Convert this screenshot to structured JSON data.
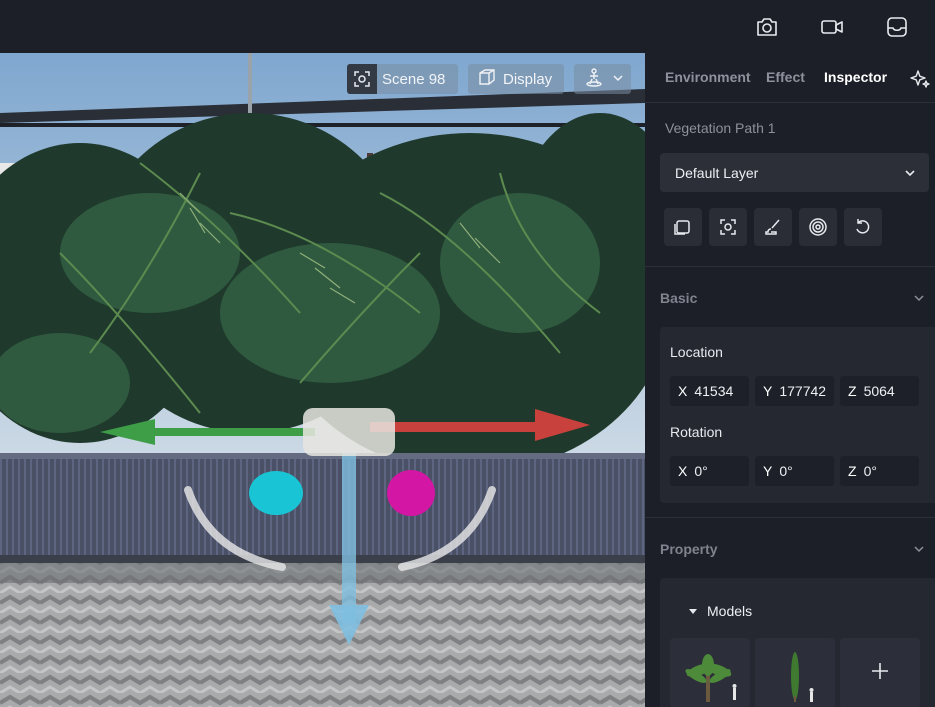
{
  "topbar": {
    "icons": [
      "camera-icon",
      "video-camera-icon",
      "inbox-tray-icon"
    ]
  },
  "viewport": {
    "scene_chip": {
      "label": "Scene 98",
      "icon": "scene-capture-icon"
    },
    "display_chip": {
      "label": "Display",
      "icon": "cube-wireframe-icon"
    },
    "view_chip": {
      "icon": "walk-person-icon",
      "dropdown": "chevron-down-icon"
    }
  },
  "panel": {
    "tabs": [
      {
        "label": "Environment",
        "active": false
      },
      {
        "label": "Effect",
        "active": false
      },
      {
        "label": "Inspector",
        "active": true
      }
    ],
    "ai_icon": "sparkle-icon",
    "object_name": "Vegetation Path 1",
    "layer": {
      "selected": "Default Layer"
    },
    "tool_icons": [
      "square-stack-icon",
      "focus-icon",
      "brush-icon",
      "target-icon",
      "reset-icon"
    ],
    "basic": {
      "title": "Basic",
      "location": {
        "label": "Location",
        "x": {
          "axis": "X",
          "value": "41534"
        },
        "y": {
          "axis": "Y",
          "value": "177742"
        },
        "z": {
          "axis": "Z",
          "value": "5064"
        }
      },
      "rotation": {
        "label": "Rotation",
        "x": {
          "axis": "X",
          "value": "0°"
        },
        "y": {
          "axis": "Y",
          "value": "0°"
        },
        "z": {
          "axis": "Z",
          "value": "0°"
        }
      }
    },
    "property": {
      "title": "Property",
      "models": {
        "label": "Models",
        "items": [
          "palm-tree-model",
          "cypress-tree-model"
        ],
        "add_icon": "plus-icon"
      }
    }
  },
  "colors": {
    "panel_bg": "#1c1f27",
    "accent_gizmo_x": "#c8413d",
    "accent_gizmo_y": "#3d9b45",
    "accent_gizmo_z": "#6fb4d8"
  }
}
